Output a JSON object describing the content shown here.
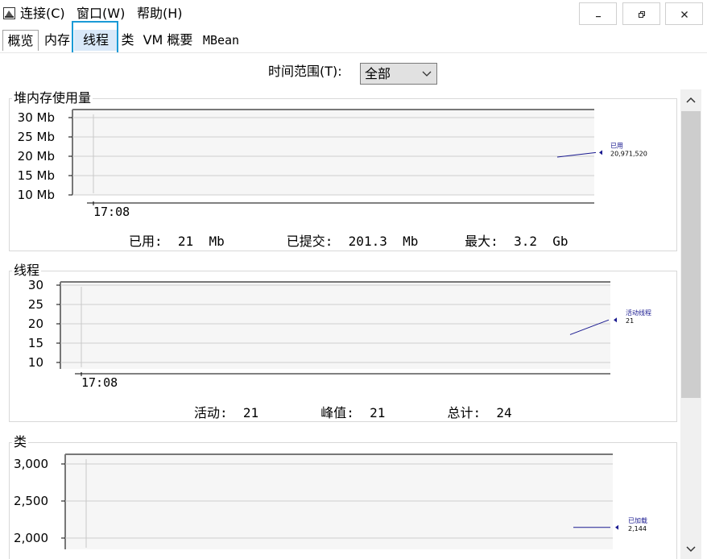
{
  "menubar": {
    "items": [
      "连接(C)",
      "窗口(W)",
      "帮助(H)"
    ]
  },
  "window_controls": [
    "minimize-icon",
    "restore-icon",
    "close-icon"
  ],
  "tabs": [
    "概览",
    "内存",
    "线程",
    "类",
    "VM 概要",
    "MBean"
  ],
  "active_tab": "概览",
  "highlighted_tab": "线程",
  "time_range": {
    "label": "时间范围(T):",
    "value": "全部"
  },
  "colors": {
    "highlight": "#1a9ad6",
    "series": "#1a1a90",
    "tab_active_bg": "#d9e9f9"
  },
  "panels": {
    "heap": {
      "title": "堆内存使用量",
      "legend_name": "已用",
      "legend_value": "20,971,520",
      "summary": {
        "used_label": "已用:",
        "used_value": "21",
        "used_unit": "Mb",
        "committed_label": "已提交:",
        "committed_value": "201.3",
        "committed_unit": "Mb",
        "max_label": "最大:",
        "max_value": "3.2",
        "max_unit": "Gb"
      }
    },
    "threads": {
      "title": "线程",
      "legend_name": "活动线程",
      "legend_value": "21",
      "summary": {
        "live_label": "活动:",
        "live_value": "21",
        "peak_label": "峰值:",
        "peak_value": "21",
        "total_label": "总计:",
        "total_value": "24"
      }
    },
    "classes": {
      "title": "类",
      "legend_name": "已加载",
      "legend_value": "2,144"
    }
  },
  "chart_data": [
    {
      "type": "line",
      "title": "堆内存使用量",
      "ytick_labels": [
        "30 Mb",
        "25 Mb",
        "20 Mb",
        "15 Mb",
        "10 Mb"
      ],
      "yticks": [
        30,
        25,
        20,
        15,
        10
      ],
      "ylim": [
        8,
        32
      ],
      "xtick_labels": [
        "17:08"
      ],
      "series": [
        {
          "name": "已用",
          "values": [
            19.8,
            20.97
          ]
        }
      ],
      "legend": "right",
      "grid": true
    },
    {
      "type": "line",
      "title": "线程",
      "ytick_labels": [
        "30",
        "25",
        "20",
        "15",
        "10"
      ],
      "yticks": [
        30,
        25,
        20,
        15,
        10
      ],
      "ylim": [
        8,
        32
      ],
      "xtick_labels": [
        "17:08"
      ],
      "series": [
        {
          "name": "活动线程",
          "values": [
            17.2,
            21
          ]
        }
      ],
      "legend": "right",
      "grid": true
    },
    {
      "type": "line",
      "title": "类",
      "ytick_labels": [
        "3,000",
        "2,500",
        "2,000"
      ],
      "yticks": [
        3000,
        2500,
        2000
      ],
      "ylim": [
        1900,
        3050
      ],
      "xtick_labels": [
        "17:08"
      ],
      "series": [
        {
          "name": "已加载",
          "values": [
            2144,
            2144
          ]
        }
      ],
      "legend": "right",
      "grid": true
    }
  ]
}
